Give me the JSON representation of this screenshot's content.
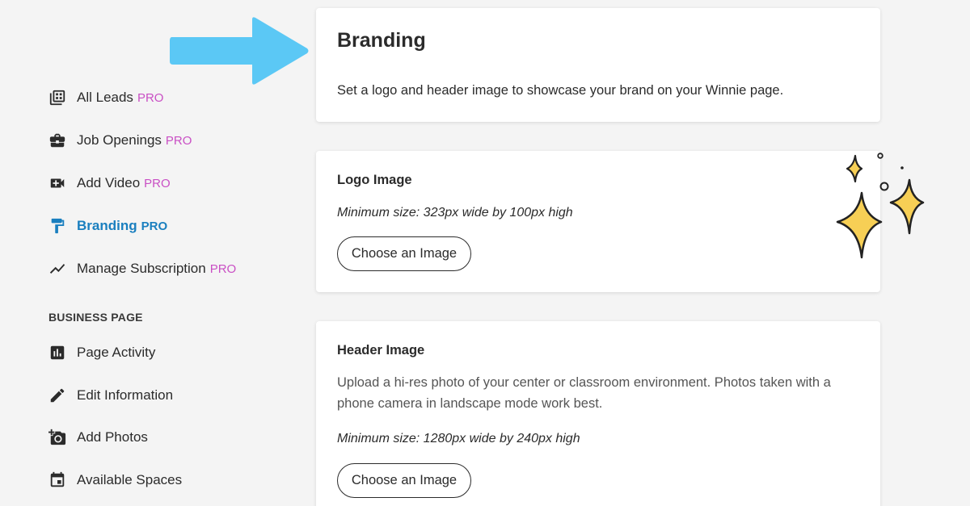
{
  "sidebar": {
    "items": [
      {
        "label": "All Leads",
        "badge": "PRO",
        "icon": "leads-grid-icon"
      },
      {
        "label": "Job Openings",
        "badge": "PRO",
        "icon": "briefcase-icon"
      },
      {
        "label": "Add Video",
        "badge": "PRO",
        "icon": "video-plus-icon"
      },
      {
        "label": "Branding",
        "badge": "PRO",
        "icon": "paint-roller-icon",
        "active": true
      },
      {
        "label": "Manage Subscription",
        "badge": "PRO",
        "icon": "trend-line-icon"
      }
    ],
    "section_label": "BUSINESS PAGE",
    "business_items": [
      {
        "label": "Page Activity",
        "icon": "bar-chart-icon"
      },
      {
        "label": "Edit Information",
        "icon": "pencil-icon"
      },
      {
        "label": "Add Photos",
        "icon": "camera-plus-icon"
      },
      {
        "label": "Available Spaces",
        "icon": "calendar-icon"
      }
    ]
  },
  "branding": {
    "title": "Branding",
    "description": "Set a logo and header image to showcase your brand on your Winnie page."
  },
  "logo_card": {
    "title": "Logo Image",
    "min_size": "Minimum size: 323px wide by 100px high",
    "button": "Choose an Image"
  },
  "header_card": {
    "title": "Header Image",
    "description": "Upload a hi-res photo of your center or classroom environment. Photos taken with a phone camera in landscape mode work best.",
    "min_size": "Minimum size: 1280px wide by 240px high",
    "button": "Choose an Image"
  },
  "colors": {
    "accent_active": "#1a7fbf",
    "pro_badge": "#c94fc4",
    "arrow": "#5bc8f5",
    "sparkle": "#f7cf55"
  }
}
